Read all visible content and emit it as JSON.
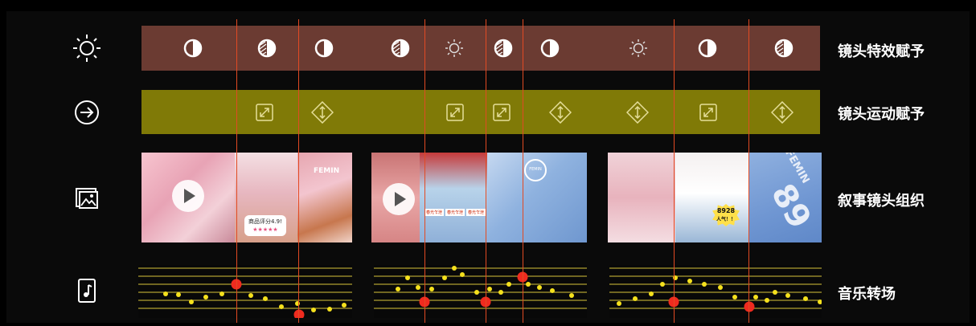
{
  "rows": {
    "effect": {
      "icon": "sun-icon",
      "label": "镜头特效赋予",
      "color": "#6b3b32",
      "symbols": [
        "half-circle",
        "striped-half-circle",
        "half-circle",
        "striped-half-circle",
        "sun",
        "striped-half-circle",
        "half-circle",
        "sun",
        "half-circle",
        "striped-half-circle"
      ]
    },
    "motion": {
      "icon": "enter-arrow-icon",
      "label": "镜头运动赋予",
      "color": "#807a07",
      "symbols": [
        "expand-box",
        "diamond-arrows",
        "expand-box",
        "expand-box",
        "diamond-arrows",
        "diamond-arrows",
        "expand-box",
        "diamond-arrows"
      ]
    },
    "narrative": {
      "icon": "photo-gallery-icon",
      "label": "叙事镜头组织",
      "groups": [
        {
          "photos": [
            {
              "desc": "girl-pink-house",
              "play": true
            },
            {
              "desc": "girl-pink-jacket",
              "rating": "商品评分4.9!",
              "stars": "★★★★★"
            },
            {
              "desc": "girl-with-dog",
              "text": "FEMIN"
            }
          ]
        },
        {
          "photos": [
            {
              "desc": "girl-pink-bg",
              "play": true
            },
            {
              "desc": "two-girls-denim",
              "tags": [
                "春光乍泄",
                "春光乍泄",
                "春光乍泄"
              ]
            },
            {
              "desc": "jacket-closeup",
              "logo": "FEMIN"
            }
          ]
        },
        {
          "photos": [
            {
              "desc": "girl-pink-fence"
            },
            {
              "desc": "girl-white-jacket",
              "badge_num": "8928",
              "badge_text": "人气！！"
            },
            {
              "desc": "jersey-back",
              "jersey": "FEMIN",
              "number": "89"
            }
          ]
        }
      ]
    },
    "music": {
      "icon": "music-file-icon",
      "label": "音乐转场"
    }
  },
  "accent_line_color": "#e24a23",
  "note_color": "#f5e11d",
  "transition_color": "#ef2b1f"
}
